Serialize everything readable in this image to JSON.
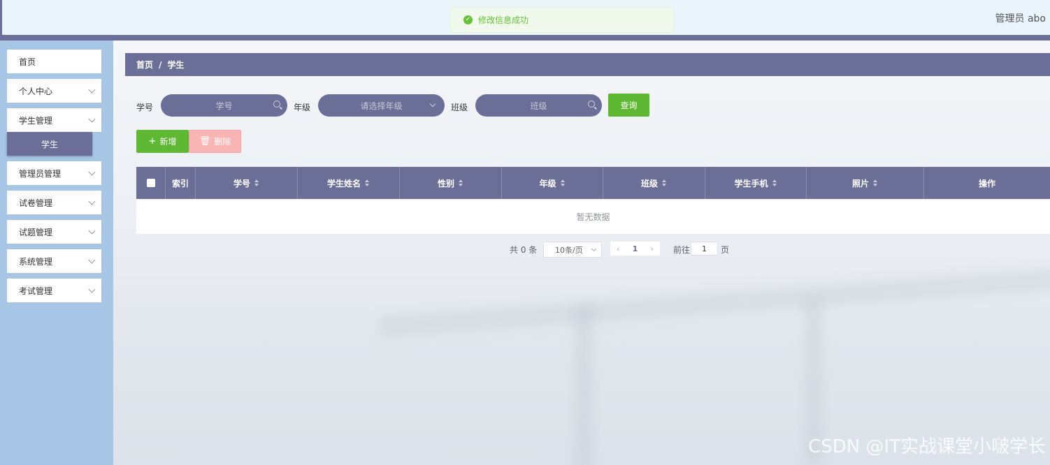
{
  "header": {
    "user": "管理员 abo",
    "toast": "修改信息成功"
  },
  "sidebar": {
    "items": [
      {
        "label": "首页"
      },
      {
        "label": "个人中心"
      },
      {
        "label": "学生管理"
      },
      {
        "label": "管理员管理"
      },
      {
        "label": "试卷管理"
      },
      {
        "label": "试题管理"
      },
      {
        "label": "系统管理"
      },
      {
        "label": "考试管理"
      }
    ],
    "active_sub": "学生"
  },
  "breadcrumb": {
    "home": "首页",
    "sep": "/",
    "current": "学生"
  },
  "filters": {
    "student_no_label": "学号",
    "student_no_placeholder": "学号",
    "grade_label": "年级",
    "grade_placeholder": "请选择年级",
    "class_label": "班级",
    "class_placeholder": "班级",
    "search_button": "查询"
  },
  "actions": {
    "add": "新增",
    "delete": "删除"
  },
  "table": {
    "columns": [
      "索引",
      "学号",
      "学生姓名",
      "性别",
      "年级",
      "班级",
      "学生手机",
      "照片",
      "操作"
    ],
    "empty_text": "暂无数据"
  },
  "pagination": {
    "total": "共 0 条",
    "page_size": "10条/页",
    "current_page": "1",
    "goto_label": "前往",
    "goto_value": "1",
    "page_suffix": "页"
  },
  "watermark": "CSDN @IT实战课堂小啵学长",
  "colors": {
    "primary": "#6b6e96",
    "success": "#5fb833",
    "danger_light": "#f9b4b4",
    "sidebar": "#a7c6e6"
  }
}
